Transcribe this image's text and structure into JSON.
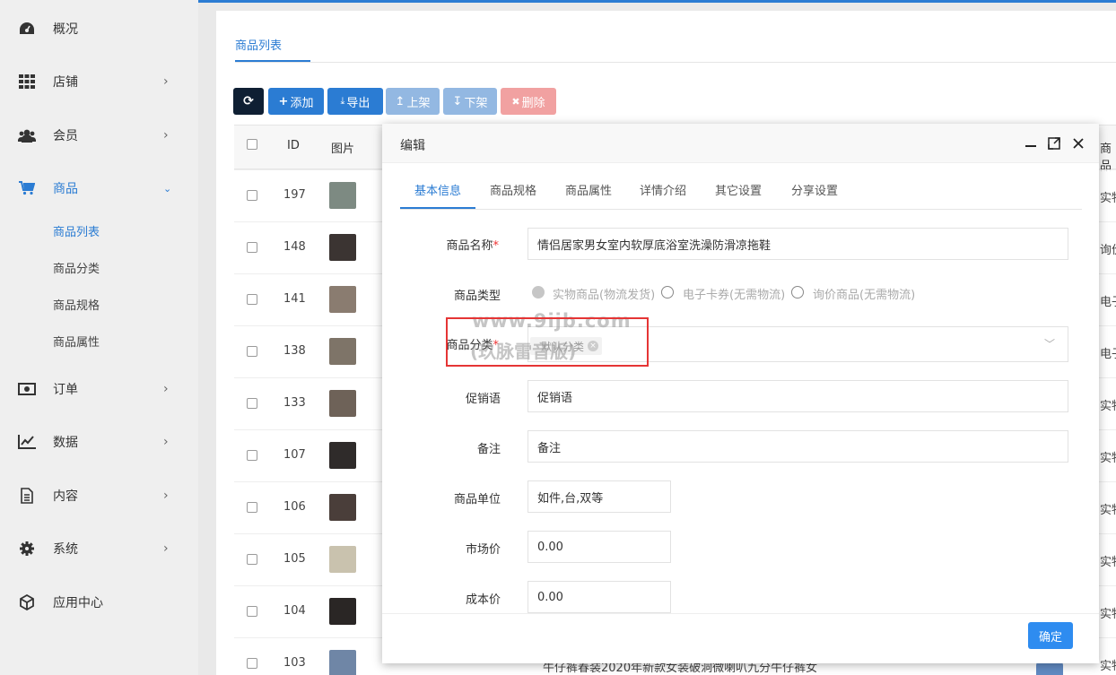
{
  "sidebar": {
    "items": [
      {
        "label": "概况",
        "icon": "dashboard-icon"
      },
      {
        "label": "店铺",
        "icon": "grid-icon"
      },
      {
        "label": "会员",
        "icon": "users-icon"
      },
      {
        "label": "商品",
        "icon": "cart-icon"
      },
      {
        "label": "订单",
        "icon": "money-icon"
      },
      {
        "label": "数据",
        "icon": "chart-icon"
      },
      {
        "label": "内容",
        "icon": "document-icon"
      },
      {
        "label": "系统",
        "icon": "gear-icon"
      },
      {
        "label": "应用中心",
        "icon": "cube-icon"
      }
    ],
    "subitems": [
      "商品列表",
      "商品分类",
      "商品规格",
      "商品属性"
    ]
  },
  "main": {
    "tab": "商品列表",
    "toolbar": {
      "add": "添加",
      "export": "导出",
      "up": "上架",
      "down": "下架",
      "delete": "删除"
    },
    "table": {
      "headers": {
        "id": "ID",
        "image": "图片",
        "right": "商品"
      },
      "rows": [
        {
          "id": "197",
          "type": "实物"
        },
        {
          "id": "148",
          "type": "询价"
        },
        {
          "id": "141",
          "type": "电子"
        },
        {
          "id": "138",
          "type": "电子"
        },
        {
          "id": "133",
          "type": "实物"
        },
        {
          "id": "107",
          "type": "实物"
        },
        {
          "id": "106",
          "type": "实物"
        },
        {
          "id": "105",
          "type": "实物"
        },
        {
          "id": "104",
          "type": "实物"
        },
        {
          "id": "103",
          "type": "实物"
        }
      ],
      "partial_name": "牛仔裤春装2020年新款女装破洞微喇叭九分牛仔裤女"
    }
  },
  "modal": {
    "title": "编辑",
    "tabs": [
      "基本信息",
      "商品规格",
      "商品属性",
      "详情介绍",
      "其它设置",
      "分享设置"
    ],
    "form": {
      "name_label": "商品名称",
      "name_value": "情侣居家男女室内软厚底浴室洗澡防滑凉拖鞋",
      "type_label": "商品类型",
      "type_options": [
        "实物商品(物流发货)",
        "电子卡券(无需物流)",
        "询价商品(无需物流)"
      ],
      "category_label": "商品分类",
      "category_chip": "默认分类",
      "promo_label": "促销语",
      "promo_value": "促销语",
      "remark_label": "备注",
      "remark_value": "备注",
      "unit_label": "商品单位",
      "unit_value": "如件,台,双等",
      "market_label": "市场价",
      "market_value": "0.00",
      "cost_label": "成本价",
      "cost_value": "0.00"
    },
    "confirm": "确定"
  },
  "watermark": {
    "line1": "www.9ijb.com",
    "line2": "(玖脉雷音版)"
  },
  "colors": {
    "accent": "#2b7cd3",
    "required": "#e33333",
    "highlight_box": "#e53535",
    "confirm": "#2e8cf0"
  }
}
